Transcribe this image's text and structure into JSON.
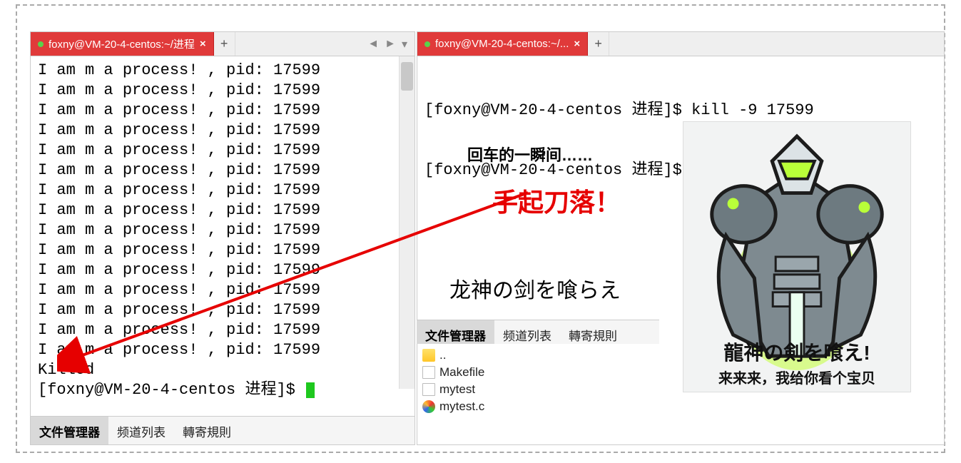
{
  "left": {
    "tab_title": "foxny@VM-20-4-centos:~/进程",
    "output_line": "I am m a process! , pid: 17599",
    "output_repeat": 15,
    "killed": "Killed",
    "prompt": "[foxny@VM-20-4-centos 进程]$ ",
    "status_tabs": [
      "文件管理器",
      "频道列表",
      "轉寄規則"
    ]
  },
  "right": {
    "tab_title": "foxny@VM-20-4-centos:~/...",
    "line1": "[foxny@VM-20-4-centos 进程]$ kill -9 17599",
    "line2": "[foxny@VM-20-4-centos 进程]$ ",
    "status_tabs": [
      "文件管理器",
      "频道列表",
      "轉寄規則"
    ],
    "files": {
      "parent": "..",
      "items": [
        "Makefile",
        "mytest",
        "mytest.c"
      ]
    }
  },
  "annot": {
    "a1": "回车的一瞬间……",
    "a2": "手起刀落！",
    "a3": "龙神の剑を喰らえ"
  },
  "genji": {
    "caption1": "龍神の剣を喰え!",
    "caption2": "来来来，我给你看个宝贝"
  }
}
